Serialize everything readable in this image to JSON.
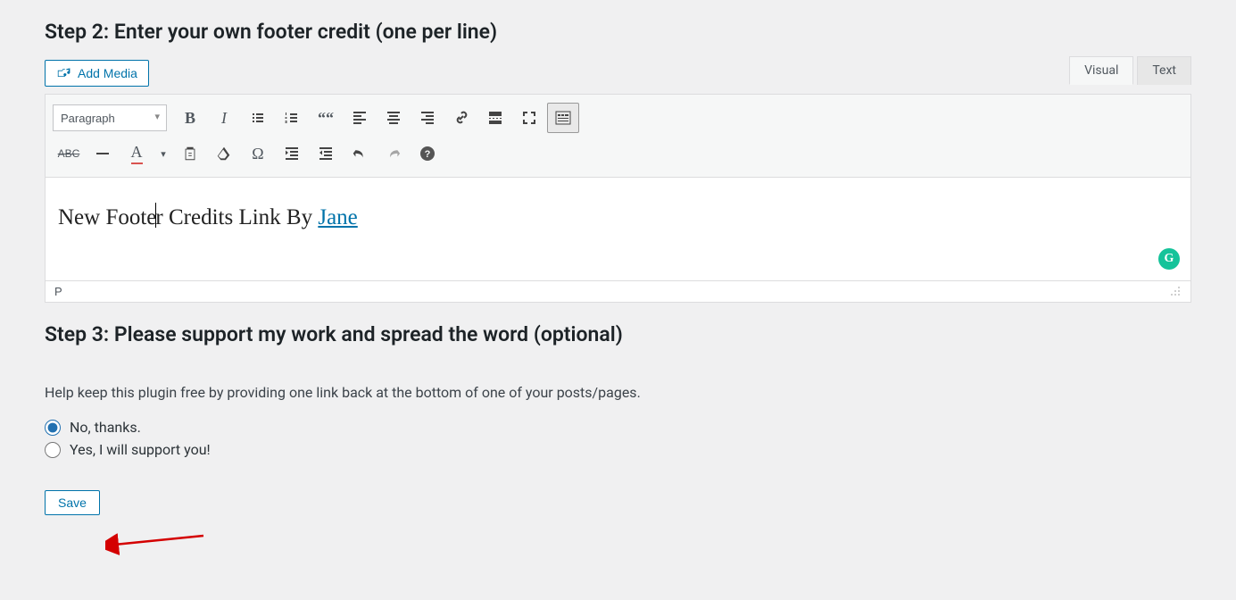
{
  "step2": {
    "heading": "Step 2: Enter your own footer credit (one per line)",
    "add_media_label": "Add Media",
    "tabs": {
      "visual": "Visual",
      "text": "Text"
    },
    "format_selected": "Paragraph",
    "content_prefix": "New Foote",
    "content_mid": "r Credits Link By ",
    "content_link": "Jane",
    "status_path": "P"
  },
  "step3": {
    "heading": "Step 3: Please support my work and spread the word (optional)",
    "help_text": "Help keep this plugin free by providing one link back at the bottom of one of your posts/pages.",
    "option_no": "No, thanks.",
    "option_yes": "Yes, I will support you!",
    "selected": "no"
  },
  "save_label": "Save",
  "grammarly_glyph": "G"
}
